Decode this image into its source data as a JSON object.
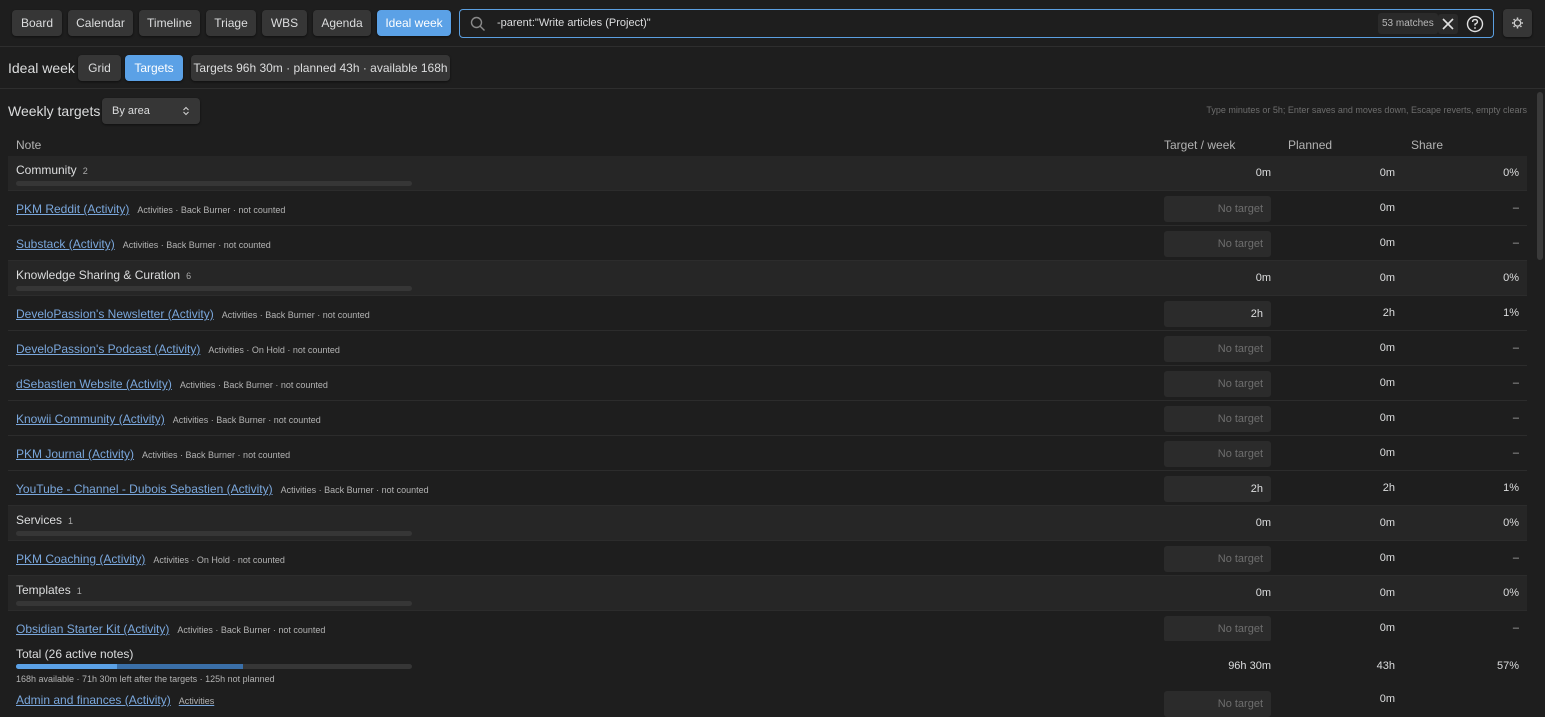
{
  "toolbar": {
    "tabs": [
      {
        "label": "Board",
        "active": false
      },
      {
        "label": "Calendar",
        "active": false
      },
      {
        "label": "Timeline",
        "active": false
      },
      {
        "label": "Triage",
        "active": false
      },
      {
        "label": "WBS",
        "active": false
      },
      {
        "label": "Agenda",
        "active": false
      },
      {
        "label": "Ideal week",
        "active": true
      }
    ],
    "search": {
      "icon": "search-icon",
      "query": "-parent:\"Write articles (Project)\"",
      "matches": "53 matches",
      "clear_icon": "close-icon",
      "help_icon": "help-circle-icon"
    },
    "settings_icon": "gear-icon"
  },
  "subbar": {
    "title": "Ideal week",
    "chips": [
      {
        "label": "Grid",
        "active": false
      },
      {
        "label": "Targets",
        "active": true
      }
    ],
    "summary": "Targets 96h 30m · planned 43h · available 168h"
  },
  "weekly": {
    "title": "Weekly targets",
    "group_by": "By area",
    "hint": "Type minutes or 5h; Enter saves and moves down, Escape reverts, empty clears",
    "columns": {
      "note": "Note",
      "target": "Target / week",
      "planned": "Planned",
      "share": "Share"
    }
  },
  "rows": [
    {
      "kind": "area",
      "name": "Community",
      "count": "2",
      "target": "0m",
      "planned": "0m",
      "share": "0%"
    },
    {
      "kind": "note",
      "name": "PKM Reddit (Activity)",
      "meta": "Activities · Back Burner · not counted",
      "target": "",
      "placeholder": "No target",
      "planned": "0m",
      "share": "–"
    },
    {
      "kind": "note",
      "name": "Substack (Activity)",
      "meta": "Activities · Back Burner · not counted",
      "target": "",
      "placeholder": "No target",
      "planned": "0m",
      "share": "–"
    },
    {
      "kind": "area",
      "name": "Knowledge Sharing & Curation",
      "count": "6",
      "target": "0m",
      "planned": "0m",
      "share": "0%"
    },
    {
      "kind": "note",
      "name": "DeveloPassion's Newsletter (Activity)",
      "meta": "Activities · Back Burner · not counted",
      "target": "2h",
      "placeholder": "No target",
      "planned": "2h",
      "share": "1%"
    },
    {
      "kind": "note",
      "name": "DeveloPassion's Podcast (Activity)",
      "meta": "Activities · On Hold · not counted",
      "target": "",
      "placeholder": "No target",
      "planned": "0m",
      "share": "–"
    },
    {
      "kind": "note",
      "name": "dSebastien Website (Activity)",
      "meta": "Activities · Back Burner · not counted",
      "target": "",
      "placeholder": "No target",
      "planned": "0m",
      "share": "–"
    },
    {
      "kind": "note",
      "name": "Knowii Community (Activity)",
      "meta": "Activities · Back Burner · not counted",
      "target": "",
      "placeholder": "No target",
      "planned": "0m",
      "share": "–"
    },
    {
      "kind": "note",
      "name": "PKM Journal (Activity)",
      "meta": "Activities · Back Burner · not counted",
      "target": "",
      "placeholder": "No target",
      "planned": "0m",
      "share": "–"
    },
    {
      "kind": "note",
      "name": "YouTube - Channel - Dubois Sebastien (Activity)",
      "meta": "Activities · Back Burner · not counted",
      "target": "2h",
      "placeholder": "No target",
      "planned": "2h",
      "share": "1%"
    },
    {
      "kind": "area",
      "name": "Services",
      "count": "1",
      "target": "0m",
      "planned": "0m",
      "share": "0%"
    },
    {
      "kind": "note",
      "name": "PKM Coaching (Activity)",
      "meta": "Activities · On Hold · not counted",
      "target": "",
      "placeholder": "No target",
      "planned": "0m",
      "share": "–"
    },
    {
      "kind": "area",
      "name": "Templates",
      "count": "1",
      "target": "0m",
      "planned": "0m",
      "share": "0%"
    },
    {
      "kind": "note",
      "name": "Obsidian Starter Kit (Activity)",
      "meta": "Activities · Back Burner · not counted",
      "target": "",
      "placeholder": "No target",
      "planned": "0m",
      "share": "–"
    }
  ],
  "total": {
    "label": "Total (26 active notes)",
    "target": "96h 30m",
    "planned": "43h",
    "share": "57%",
    "sub": "168h available · 71h 30m left after the targets · 125h not planned",
    "targets_fraction": 0.574,
    "planned_fraction": 0.256
  },
  "cut_row": {
    "name": "Admin and finances (Activity)",
    "meta": "Activities",
    "placeholder": "No target",
    "planned": "0m"
  },
  "colors": {
    "accent": "#5ba1e6",
    "link": "#7aa7dc",
    "background": "#1e1e1e"
  }
}
